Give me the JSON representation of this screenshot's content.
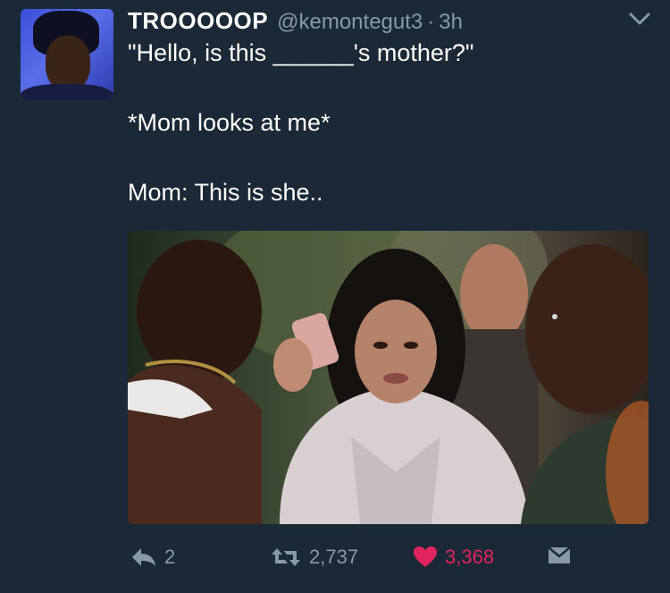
{
  "tweet": {
    "display_name": "TROOOOOP",
    "handle": "@kemontegut3",
    "separator": "·",
    "time": "3h",
    "lines": [
      "\"Hello, is this ______'s mother?\"",
      "*Mom looks at me*",
      "Mom: This is she.."
    ]
  },
  "actions": {
    "reply_count": "2",
    "retweet_count": "2,737",
    "like_count": "3,368"
  },
  "colors": {
    "background": "#1b2836",
    "muted": "#8899a6",
    "like": "#e0245e"
  },
  "icons": [
    "chevron-down-icon",
    "reply-icon",
    "retweet-icon",
    "heart-icon",
    "envelope-icon"
  ]
}
